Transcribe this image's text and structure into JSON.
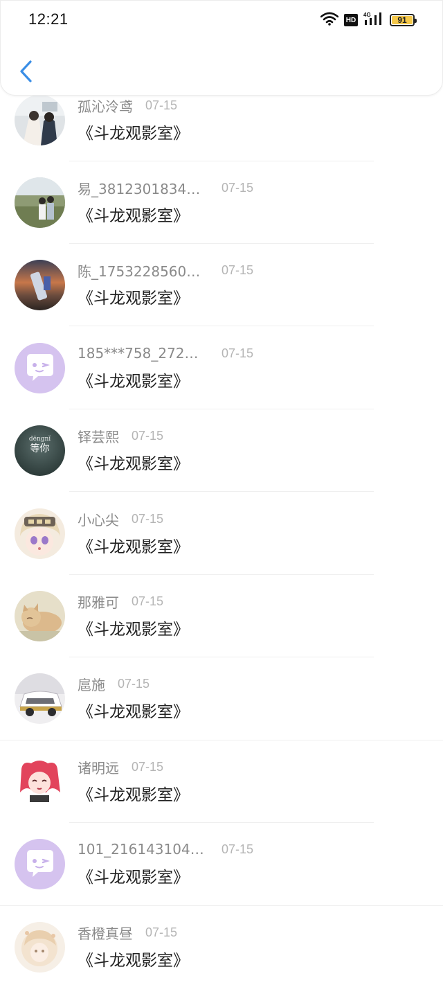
{
  "status_bar": {
    "time": "12:21",
    "battery": "91",
    "icons": [
      "wifi-icon",
      "hd-icon",
      "4g-signal-icon",
      "battery-icon"
    ]
  },
  "header": {
    "back_icon": "chevron-left-icon",
    "accent_color": "#3a8ee6"
  },
  "messages": [
    {
      "name": "孤沁泠鸢",
      "date": "07-15",
      "text": "《斗龙观影室》",
      "avatar": "photo-girls"
    },
    {
      "name": "易_381230183463...",
      "date": "07-15",
      "text": "《斗龙观影室》",
      "avatar": "photo-field"
    },
    {
      "name": "陈_175322856018...",
      "date": "07-15",
      "text": "《斗龙观影室》",
      "avatar": "photo-sunset"
    },
    {
      "name": "185***758_27294...",
      "date": "07-15",
      "text": "《斗龙观影室》",
      "avatar": "default-chat"
    },
    {
      "name": "铎芸熙",
      "date": "07-15",
      "text": "《斗龙观影室》",
      "avatar": "text-dengni",
      "avatar_text_top": "dēngnǐ",
      "avatar_text_bottom": "等你"
    },
    {
      "name": "小心尖",
      "date": "07-15",
      "text": "《斗龙观影室》",
      "avatar": "anime-girl"
    },
    {
      "name": "那雅可",
      "date": "07-15",
      "text": "《斗龙观影室》",
      "avatar": "kitten"
    },
    {
      "name": "扈施",
      "date": "07-15",
      "text": "《斗龙观影室》",
      "avatar": "car"
    },
    {
      "name": "诸明远",
      "date": "07-15",
      "text": "《斗龙观影室》",
      "avatar": "pink-anime"
    },
    {
      "name": "101_21614310427...",
      "date": "07-15",
      "text": "《斗龙观影室》",
      "avatar": "default-chat"
    },
    {
      "name": "香橙真昼",
      "date": "07-15",
      "text": "《斗龙观影室》",
      "avatar": "light-anime"
    }
  ]
}
